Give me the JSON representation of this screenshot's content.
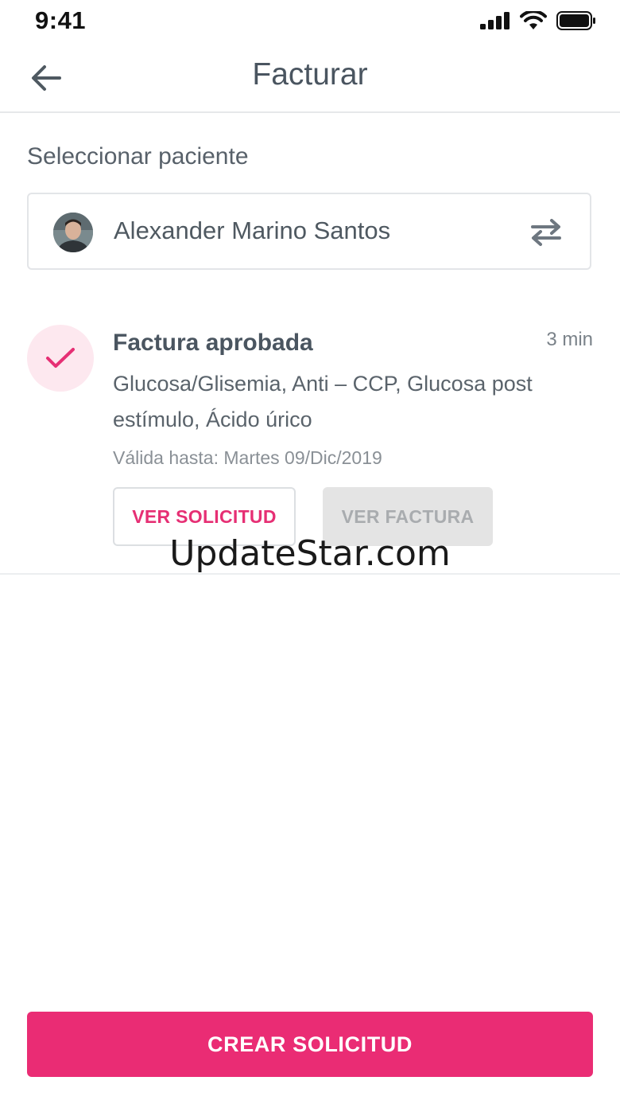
{
  "status_bar": {
    "time": "9:41"
  },
  "header": {
    "title": "Facturar"
  },
  "patient_select": {
    "label": "Seleccionar paciente",
    "name": "Alexander Marino Santos"
  },
  "notification": {
    "title": "Factura aprobada",
    "time": "3 min",
    "body": "Glucosa/Glisemia, Anti – CCP, Glucosa post estímulo, Ácido úrico",
    "valid_until": "Válida hasta: Martes 09/Dic/2019",
    "view_request_label": "VER SOLICITUD",
    "view_invoice_label": "VER FACTURA"
  },
  "watermark": "UpdateStar.com",
  "footer": {
    "create_label": "CREAR SOLICITUD"
  },
  "colors": {
    "accent": "#ea2c74",
    "accent_light": "#fde8ef",
    "disabled_bg": "#e4e4e4",
    "text": "#4a5560"
  }
}
